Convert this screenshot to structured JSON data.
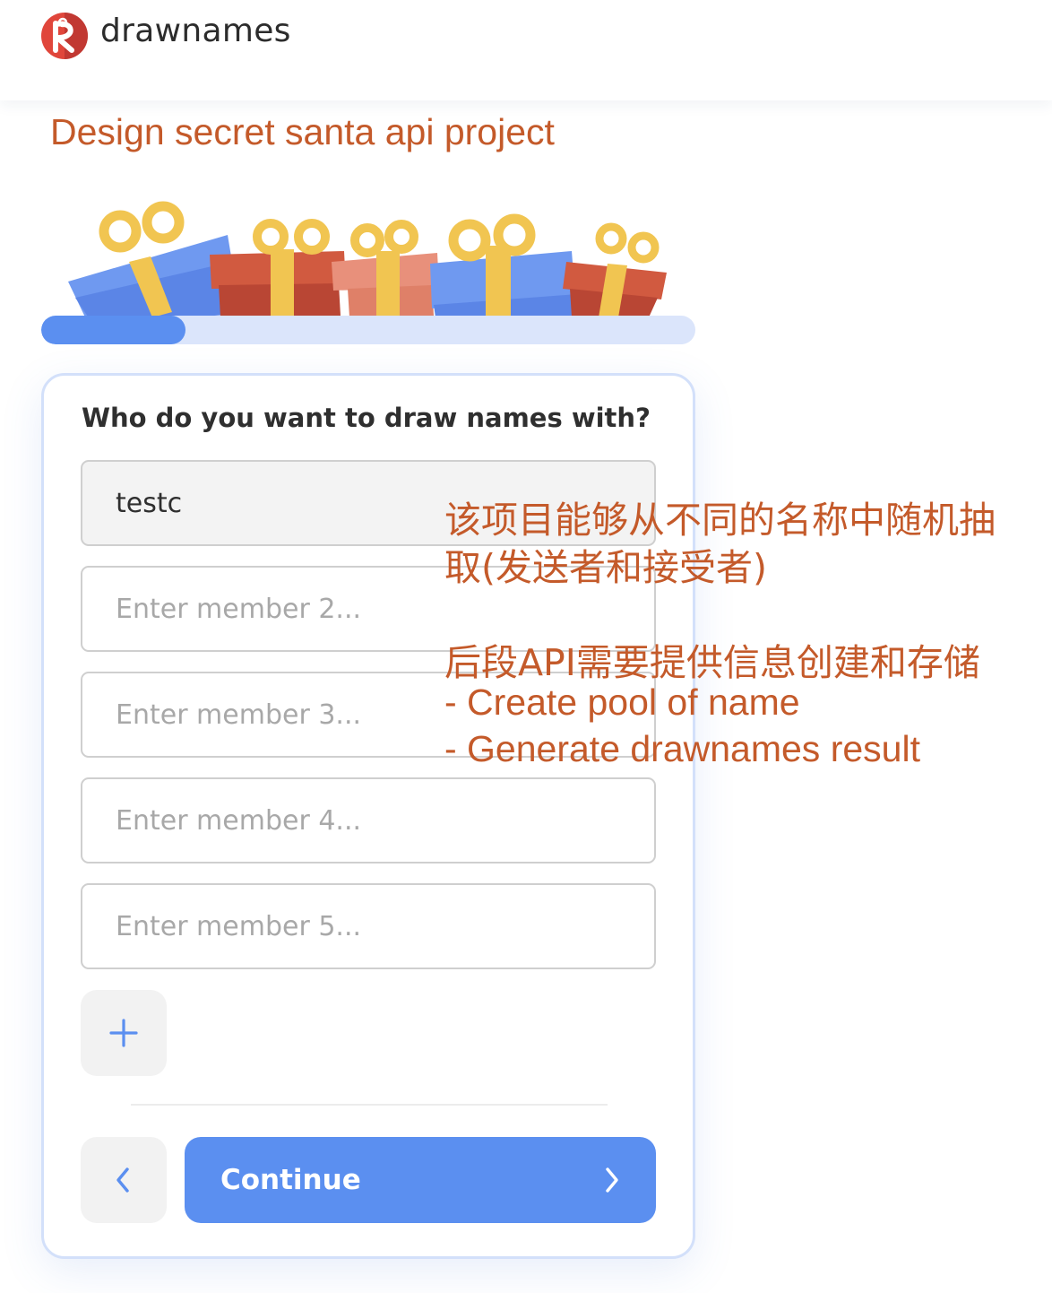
{
  "header": {
    "brand": "drawnames",
    "colors": {
      "logo": "#e0463b",
      "brand_text": "#2c2c2c"
    }
  },
  "project_title": "Design secret santa api project",
  "progress": {
    "fraction": 0.22,
    "fill_color": "#5b8ff0",
    "track_color": "#dbe5fb"
  },
  "form": {
    "question": "Who do you want to draw names with?",
    "members": [
      {
        "value": "testc",
        "placeholder": ""
      },
      {
        "value": "",
        "placeholder": "Enter member 2..."
      },
      {
        "value": "",
        "placeholder": "Enter member 3..."
      },
      {
        "value": "",
        "placeholder": "Enter member 4..."
      },
      {
        "value": "",
        "placeholder": "Enter member 5..."
      }
    ],
    "add_button_icon": "plus-icon",
    "back_button_icon": "chevron-left-icon",
    "continue_label": "Continue",
    "continue_icon": "chevron-right-icon",
    "accent_color": "#5b8ff0"
  },
  "annotation": {
    "color": "#c45a2a",
    "line1": "该项目能够从不同的名称中随机抽",
    "line2": "取(发送者和接受者)",
    "line3": "后段API需要提供信息创建和存储",
    "line4": "- Create pool of name",
    "line5": "- Generate drawnames result"
  }
}
